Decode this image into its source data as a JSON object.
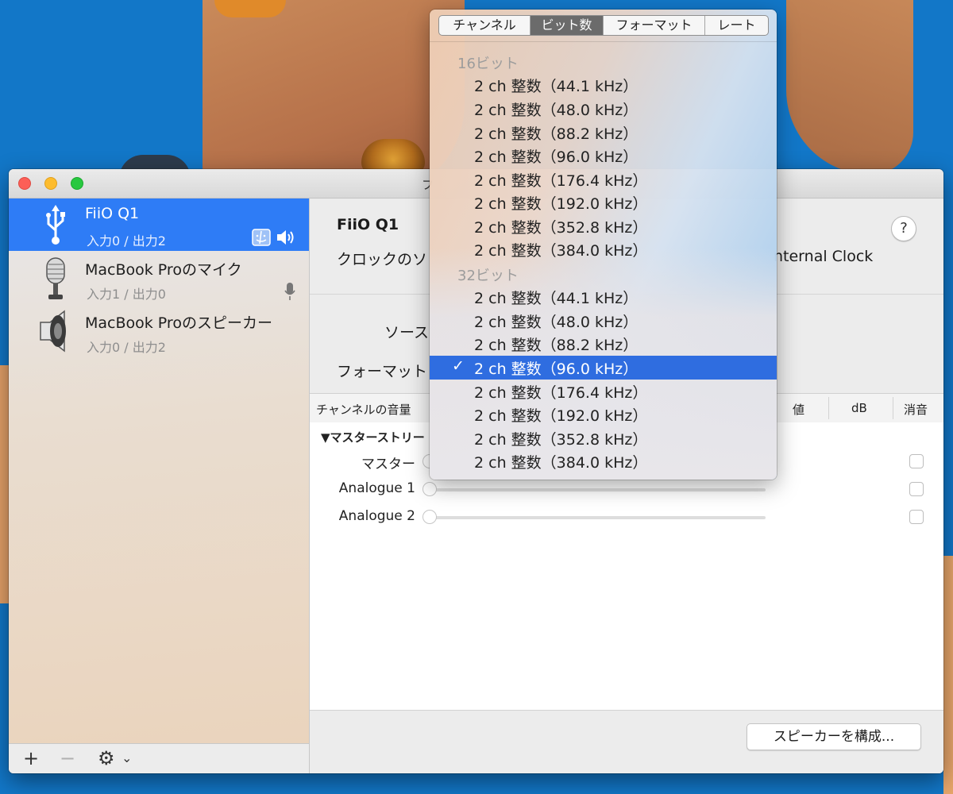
{
  "window": {
    "title_fragment": "フ"
  },
  "sidebar": {
    "devices": [
      {
        "name": "FiiO Q1",
        "io": "入力0 / 出力2",
        "icon": "usb-icon",
        "selected": true
      },
      {
        "name": "MacBook Proのマイク",
        "io": "入力1 / 出力0",
        "icon": "microphone-icon",
        "selected": false
      },
      {
        "name": "MacBook Proのスピーカー",
        "io": "入力0 / 出力2",
        "icon": "speaker-icon",
        "selected": false
      }
    ],
    "footer": {
      "add": "+",
      "remove": "−",
      "gear": "⚙",
      "gear_chevron": "⌄"
    }
  },
  "main": {
    "device_name": "FiiO Q1",
    "clock_label": "クロックのソ",
    "clock_value": "nternal Clock",
    "help": "?",
    "source_label": "ソース",
    "format_label": "フォーマット",
    "volume_header": {
      "label": "チャンネルの音量",
      "value": "値",
      "db": "dB",
      "mute": "消音"
    },
    "stream_row": "▼マスターストリー",
    "channels": [
      {
        "label": "マスター"
      },
      {
        "label": "Analogue 1"
      },
      {
        "label": "Analogue 2"
      }
    ],
    "configure_speakers": "スピーカーを構成..."
  },
  "popup": {
    "tabs": [
      {
        "label": "チャンネル",
        "active": false
      },
      {
        "label": "ビット数",
        "active": true
      },
      {
        "label": "フォーマット",
        "active": false
      },
      {
        "label": "レート",
        "active": false
      }
    ],
    "groups": [
      {
        "header": "16ビット",
        "items": [
          "2 ch 整数（44.1 kHz）",
          "2 ch 整数（48.0 kHz）",
          "2 ch 整数（88.2 kHz）",
          "2 ch 整数（96.0 kHz）",
          "2 ch 整数（176.4 kHz）",
          "2 ch 整数（192.0 kHz）",
          "2 ch 整数（352.8 kHz）",
          "2 ch 整数（384.0 kHz）"
        ]
      },
      {
        "header": "32ビット",
        "items": [
          "2 ch 整数（44.1 kHz）",
          "2 ch 整数（48.0 kHz）",
          "2 ch 整数（88.2 kHz）",
          "2 ch 整数（96.0 kHz）",
          "2 ch 整数（176.4 kHz）",
          "2 ch 整数（192.0 kHz）",
          "2 ch 整数（352.8 kHz）",
          "2 ch 整数（384.0 kHz）"
        ]
      }
    ],
    "selected": {
      "group": 1,
      "item": 3
    },
    "check": "✓"
  },
  "colors": {
    "selection": "#2f6de0",
    "sidebar_selection": "#2e7cf6",
    "desktop": "#1277c8"
  }
}
